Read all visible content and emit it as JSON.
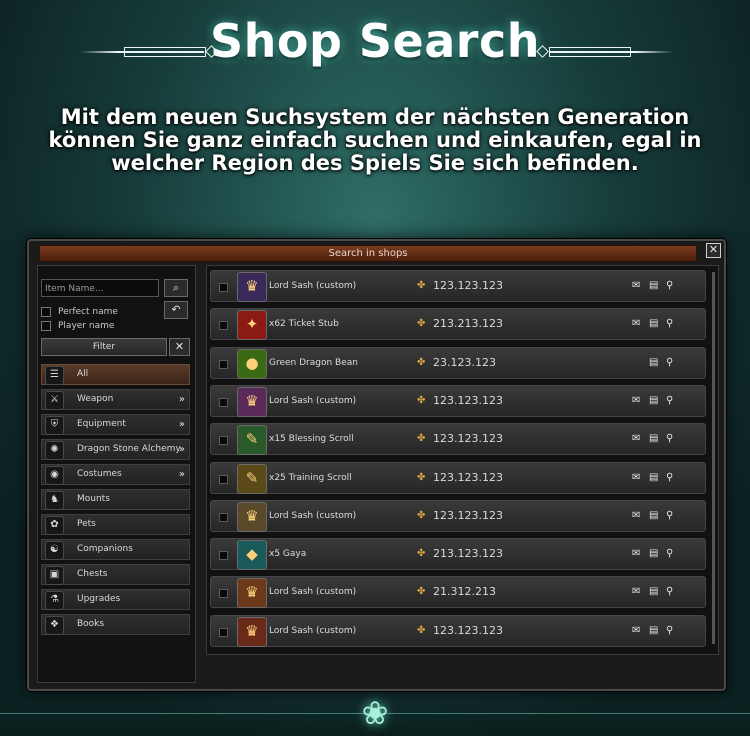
{
  "hero": {
    "title": "Shop Search",
    "description": "Mit dem neuen Suchsystem der nächsten Generation können Sie ganz einfach suchen und einkaufen, egal in welcher Region des Spiels Sie sich befinden."
  },
  "window": {
    "title": "Search in shops",
    "close_label": "✕"
  },
  "search": {
    "placeholder": "Item Name...",
    "search_icon": "⌕",
    "reset_icon": "↶",
    "perfect_name_label": "Perfect name",
    "player_name_label": "Player name",
    "filter_label": "Filter",
    "clear_icon": "✕"
  },
  "categories": [
    {
      "label": "All",
      "icon": "☰",
      "expand": ""
    },
    {
      "label": "Weapon",
      "icon": "⚔",
      "expand": "»"
    },
    {
      "label": "Equipment",
      "icon": "⛨",
      "expand": "»"
    },
    {
      "label": "Dragon Stone Alchemy",
      "icon": "✺",
      "expand": "»"
    },
    {
      "label": "Costumes",
      "icon": "◉",
      "expand": "»"
    },
    {
      "label": "Mounts",
      "icon": "♞",
      "expand": ""
    },
    {
      "label": "Pets",
      "icon": "✿",
      "expand": ""
    },
    {
      "label": "Companions",
      "icon": "☯",
      "expand": ""
    },
    {
      "label": "Chests",
      "icon": "▣",
      "expand": ""
    },
    {
      "label": "Upgrades",
      "icon": "⚗",
      "expand": ""
    },
    {
      "label": "Books",
      "icon": "❖",
      "expand": ""
    }
  ],
  "items": [
    {
      "name": "Lord Sash (custom)",
      "price": "123.123.123",
      "icon": "♛",
      "icon_color": "#3a2a5a",
      "actions": [
        "mail",
        "shop",
        "search"
      ]
    },
    {
      "name": "x62 Ticket Stub",
      "price": "213.213.123",
      "icon": "✦",
      "icon_color": "#8a1a12",
      "actions": [
        "mail",
        "shop",
        "search"
      ]
    },
    {
      "name": "Green Dragon Bean",
      "price": "23.123.123",
      "icon": "●",
      "icon_color": "#3a6a14",
      "actions": [
        "shop",
        "search"
      ]
    },
    {
      "name": "Lord Sash (custom)",
      "price": "123.123.123",
      "icon": "♛",
      "icon_color": "#5a2a5a",
      "actions": [
        "mail",
        "shop",
        "search"
      ]
    },
    {
      "name": "x15 Blessing Scroll",
      "price": "123.123.123",
      "icon": "✎",
      "icon_color": "#2a5a2a",
      "actions": [
        "mail",
        "shop",
        "search"
      ]
    },
    {
      "name": "x25 Training Scroll",
      "price": "123.123.123",
      "icon": "✎",
      "icon_color": "#5a4a1a",
      "actions": [
        "mail",
        "shop",
        "search"
      ]
    },
    {
      "name": "Lord Sash (custom)",
      "price": "123.123.123",
      "icon": "♛",
      "icon_color": "#5a4a2a",
      "actions": [
        "mail",
        "shop",
        "search"
      ]
    },
    {
      "name": "x5 Gaya",
      "price": "213.123.123",
      "icon": "◆",
      "icon_color": "#1a5a5a",
      "actions": [
        "mail",
        "shop",
        "search"
      ]
    },
    {
      "name": "Lord Sash (custom)",
      "price": "21.312.213",
      "icon": "♛",
      "icon_color": "#6a3a1a",
      "actions": [
        "mail",
        "shop",
        "search"
      ]
    },
    {
      "name": "Lord Sash (custom)",
      "price": "123.123.123",
      "icon": "♛",
      "icon_color": "#6a2a1a",
      "actions": [
        "mail",
        "shop",
        "search"
      ]
    }
  ],
  "glyphs": {
    "coin": "✤",
    "mail": "✉",
    "shop": "▤",
    "search": "⚲"
  },
  "colors": {
    "accent": "#d9a642",
    "title_bar": "#6a2f16",
    "active_category": "#5a3a28"
  }
}
